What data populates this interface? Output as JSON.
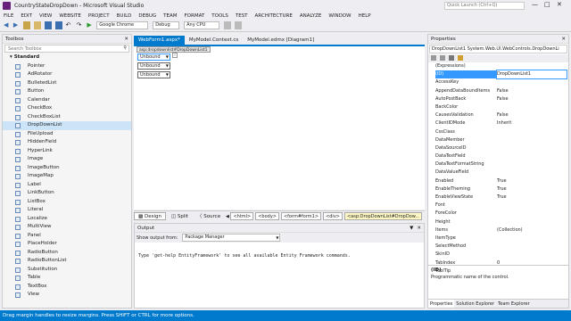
{
  "window": {
    "title": "CountryStateDropDown - Microsoft Visual Studio",
    "quick_launch": "Quick Launch (Ctrl+Q)"
  },
  "menu": [
    "FILE",
    "EDIT",
    "VIEW",
    "WEBSITE",
    "PROJECT",
    "BUILD",
    "DEBUG",
    "TEAM",
    "FORMAT",
    "TOOLS",
    "TEST",
    "ARCHITECTURE",
    "ANALYZE",
    "WINDOW",
    "HELP"
  ],
  "toolbar": {
    "browser": "Google Chrome",
    "config": "Debug",
    "platform": "Any CPU"
  },
  "toolbox": {
    "title": "Toolbox",
    "search_placeholder": "Search Toolbox",
    "group": "Standard",
    "items": [
      "Pointer",
      "AdRotator",
      "BulletedList",
      "Button",
      "Calendar",
      "CheckBox",
      "CheckBoxList",
      "DropDownList",
      "FileUpload",
      "HiddenField",
      "HyperLink",
      "Image",
      "ImageButton",
      "ImageMap",
      "Label",
      "LinkButton",
      "ListBox",
      "Literal",
      "Localize",
      "MultiView",
      "Panel",
      "PlaceHolder",
      "RadioButton",
      "RadioButtonList",
      "Substitution",
      "Table",
      "TextBox",
      "View"
    ]
  },
  "doc_tabs": [
    "WebForm1.aspx*",
    "MyModel.Context.cs",
    "MyModel.edmx [Diagram1]"
  ],
  "designer": {
    "tag_label": "asp:dropdownlist#DropDownList1",
    "dropdowns": [
      "Unbound",
      "Unbound",
      "Unbound"
    ],
    "views": [
      "Design",
      "Split",
      "Source"
    ],
    "breadcrumbs": [
      "<html>",
      "<body>",
      "<form#form1>",
      "<div>",
      "<asp:DropDownList#DropDow..."
    ]
  },
  "output": {
    "title": "Output",
    "show_label": "Show output from:",
    "source": "Package Manager",
    "text": "Type 'get-help EntityFramework' to see all available Entity Framework commands."
  },
  "properties": {
    "title": "Properties",
    "object": "DropDownList1  System.Web.UI.WebControls.DropDownLi",
    "rows": [
      {
        "name": "(Expressions)",
        "value": ""
      },
      {
        "name": "(ID)",
        "value": "DropDownList1"
      },
      {
        "name": "AccessKey",
        "value": ""
      },
      {
        "name": "AppendDataBoundItems",
        "value": "False"
      },
      {
        "name": "AutoPostBack",
        "value": "False"
      },
      {
        "name": "BackColor",
        "value": ""
      },
      {
        "name": "CausesValidation",
        "value": "False"
      },
      {
        "name": "ClientIDMode",
        "value": "Inherit"
      },
      {
        "name": "CssClass",
        "value": ""
      },
      {
        "name": "DataMember",
        "value": ""
      },
      {
        "name": "DataSourceID",
        "value": ""
      },
      {
        "name": "DataTextField",
        "value": ""
      },
      {
        "name": "DataTextFormatString",
        "value": ""
      },
      {
        "name": "DataValueField",
        "value": ""
      },
      {
        "name": "Enabled",
        "value": "True"
      },
      {
        "name": "EnableTheming",
        "value": "True"
      },
      {
        "name": "EnableViewState",
        "value": "True"
      },
      {
        "name": "Font",
        "value": ""
      },
      {
        "name": "ForeColor",
        "value": ""
      },
      {
        "name": "Height",
        "value": ""
      },
      {
        "name": "Items",
        "value": "(Collection)"
      },
      {
        "name": "ItemType",
        "value": ""
      },
      {
        "name": "SelectMethod",
        "value": ""
      },
      {
        "name": "SkinID",
        "value": ""
      },
      {
        "name": "TabIndex",
        "value": "0"
      },
      {
        "name": "ToolTip",
        "value": ""
      }
    ],
    "desc_title": "(ID)",
    "desc_text": "Programmatic name of the control.",
    "bottom_tabs": [
      "Properties",
      "Solution Explorer",
      "Team Explorer"
    ]
  },
  "status": {
    "text": "Drag margin handles to resize margins. Press SHIFT or CTRL for more options."
  },
  "colors": {
    "accent": "#007acc",
    "selected": "#3399ff"
  }
}
